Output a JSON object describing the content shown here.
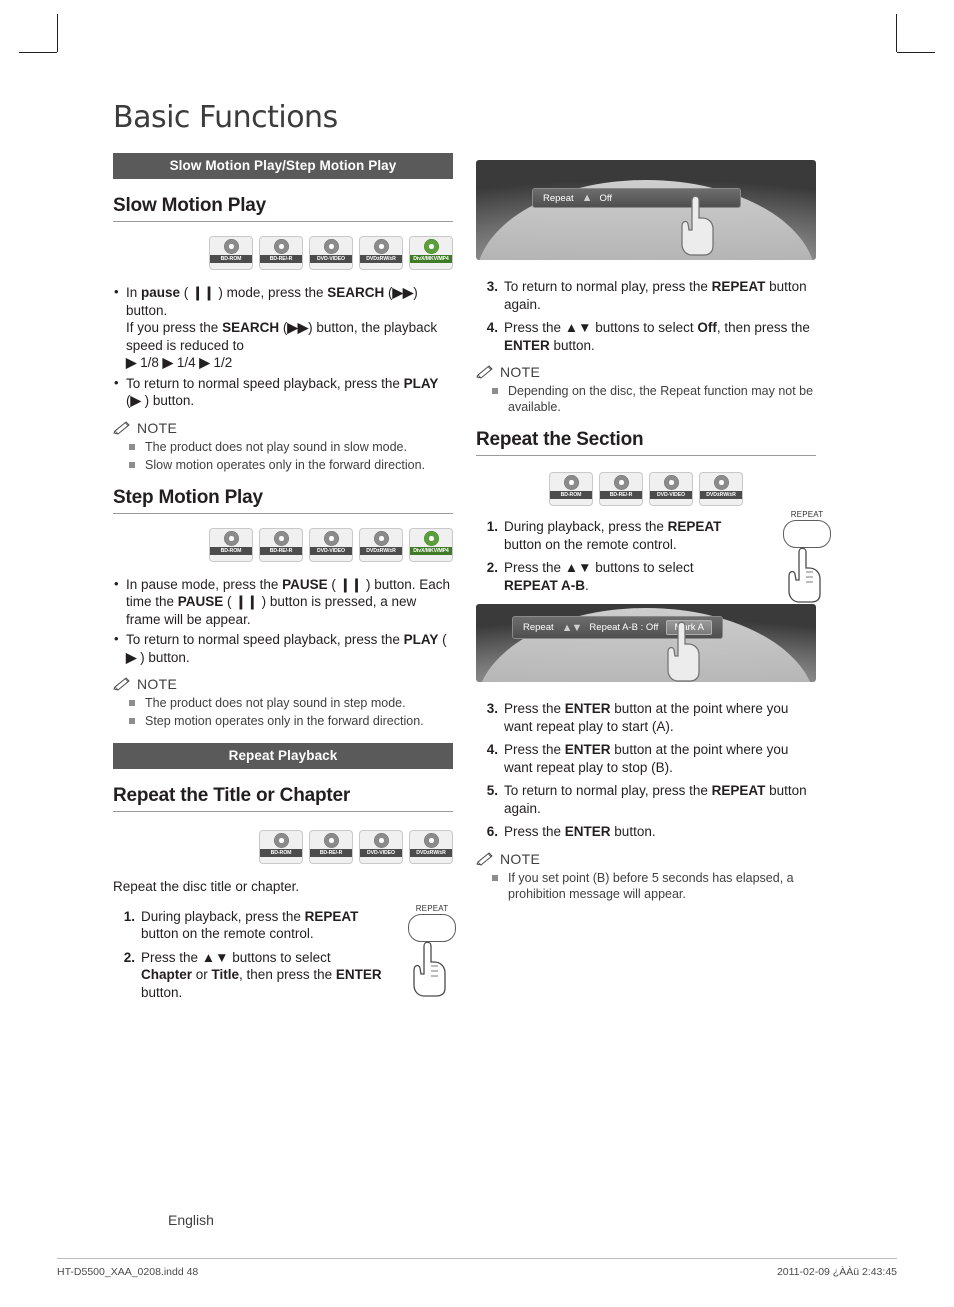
{
  "page": {
    "title": "Basic Functions",
    "language_label": "English",
    "footer_left": "HT-D5500_XAA_0208.indd   48",
    "footer_right": "2011-02-09   ¿ÀÀü 2:43:45"
  },
  "left_column": {
    "section_bar_1": "Slow Motion Play/Step Motion Play",
    "slow_motion": {
      "heading": "Slow Motion Play",
      "discs": [
        {
          "label": "BD-ROM",
          "green": false
        },
        {
          "label": "BD-RE/-R",
          "green": false
        },
        {
          "label": "DVD-VIDEO",
          "green": false
        },
        {
          "label": "DVD±RW/±R",
          "green": false
        },
        {
          "label": "DivX/MKV/MP4",
          "green": true
        }
      ],
      "bullets": [
        "In <b>pause</b> ( <b>&#10073;&#10073;</b> ) mode, press the <b>SEARCH</b> (<b>&#9654;&#9654;</b>) button.<br>If you press the <b>SEARCH</b> (<b>&#9654;&#9654;</b>) button, the playback speed is reduced to<br><b>&#9654;</b> 1/8 <b>&#9654;</b> 1/4 <b>&#9654;</b> 1/2",
        "To return to normal speed playback, press the <b>PLAY</b> (<b>&#9654;</b> ) button."
      ],
      "note_label": "NOTE",
      "notes": [
        "The product does not play sound in slow mode.",
        "Slow motion operates only in the forward direction."
      ]
    },
    "step_motion": {
      "heading": "Step Motion Play",
      "discs": [
        {
          "label": "BD-ROM",
          "green": false
        },
        {
          "label": "BD-RE/-R",
          "green": false
        },
        {
          "label": "DVD-VIDEO",
          "green": false
        },
        {
          "label": "DVD±RW/±R",
          "green": false
        },
        {
          "label": "DivX/MKV/MP4",
          "green": true
        }
      ],
      "bullets": [
        "In pause mode, press the <b>PAUSE</b> ( <b>&#10073;&#10073;</b> ) button. Each time the <b>PAUSE</b> ( <b>&#10073;&#10073;</b> ) button is pressed, a new frame will be appear.",
        "To return to normal speed playback, press the <b>PLAY</b> ( <b>&#9654;</b> ) button."
      ],
      "note_label": "NOTE",
      "notes": [
        "The product does not play sound in step mode.",
        "Step motion operates only in the forward direction."
      ]
    },
    "section_bar_2": "Repeat Playback",
    "repeat_title_chapter": {
      "heading": "Repeat the Title or Chapter",
      "discs": [
        {
          "label": "BD-ROM",
          "green": false
        },
        {
          "label": "BD-RE/-R",
          "green": false
        },
        {
          "label": "DVD-VIDEO",
          "green": false
        },
        {
          "label": "DVD±RW/±R",
          "green": false
        }
      ],
      "intro": "Repeat the disc title or chapter.",
      "steps": [
        {
          "num": "1.",
          "text": "During playback, press the <b>REPEAT</b> button on the remote control."
        },
        {
          "num": "2.",
          "text": "Press the <b>&#9650;&#9660;</b> buttons to select <b>Chapter</b> or <b>Title</b>, then press the <b>ENTER</b> button."
        }
      ],
      "remote_button_label": "REPEAT"
    }
  },
  "right_column": {
    "osd_top": {
      "row_label": "Repeat",
      "value": "Off"
    },
    "steps_top": [
      {
        "num": "3.",
        "text": "To return to normal play, press the <b>REPEAT</b> button again."
      },
      {
        "num": "4.",
        "text": "Press the <b>&#9650;&#9660;</b> buttons to select <b>Off</b>, then press the <b>ENTER</b> button."
      }
    ],
    "note_top": {
      "label": "NOTE",
      "items": [
        "Depending on the disc, the Repeat function may not be available."
      ]
    },
    "repeat_section": {
      "heading": "Repeat the Section",
      "discs": [
        {
          "label": "BD-ROM",
          "green": false
        },
        {
          "label": "BD-RE/-R",
          "green": false
        },
        {
          "label": "DVD-VIDEO",
          "green": false
        },
        {
          "label": "DVD±RW/±R",
          "green": false
        }
      ],
      "steps_a": [
        {
          "num": "1.",
          "text": "During playback, press the <b>REPEAT</b> button on the remote control."
        },
        {
          "num": "2.",
          "text": "Press the <b>&#9650;&#9660;</b> buttons to select <b>REPEAT A-B</b>."
        }
      ],
      "remote_button_label": "REPEAT",
      "osd": {
        "row_label": "Repeat",
        "value": "Repeat A-B : Off",
        "chip": "Mark A"
      },
      "steps_b": [
        {
          "num": "3.",
          "text": "Press the <b>ENTER</b> button at the point where you want repeat play to start (A)."
        },
        {
          "num": "4.",
          "text": "Press the <b>ENTER</b> button at the point where you want repeat play to stop (B)."
        },
        {
          "num": "5.",
          "text": "To return to normal play, press the <b>REPEAT</b> button again."
        },
        {
          "num": "6.",
          "text": "Press the <b>ENTER</b> button."
        }
      ],
      "note": {
        "label": "NOTE",
        "items": [
          "If you set point (B) before 5 seconds has elapsed, a prohibition message will appear."
        ]
      }
    }
  }
}
